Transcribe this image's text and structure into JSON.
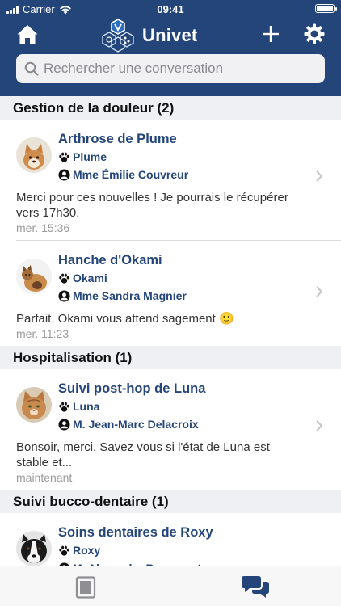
{
  "status_bar": {
    "carrier": "Carrier",
    "time": "09:41"
  },
  "header": {
    "app_name": "Univet",
    "accent_color": "#24457a",
    "icons": [
      "home-icon",
      "univet-logo",
      "plus-icon",
      "gear-icon"
    ]
  },
  "search": {
    "placeholder": "Rechercher une conversation",
    "value": ""
  },
  "sections": [
    {
      "title": "Gestion de la douleur (2)",
      "rows": [
        {
          "title": "Arthrose de Plume",
          "pet": "Plume",
          "owner": "Mme Émilie Couvreur",
          "message": "Merci pour ces nouvelles ! Je pourrais le récupérer vers 17h30.",
          "time": "mer. 15:36"
        },
        {
          "title": "Hanche d'Okami",
          "pet": "Okami",
          "owner": "Mme Sandra Magnier",
          "message": "Parfait, Okami vous attend sagement 🙂",
          "time": "mer. 11:23"
        }
      ]
    },
    {
      "title": "Hospitalisation (1)",
      "rows": [
        {
          "title": "Suivi post-hop de Luna",
          "pet": "Luna",
          "owner": "M. Jean-Marc Delacroix",
          "message": "Bonsoir, merci. Savez vous si l'état de Luna est stable et...",
          "time": "maintenant"
        }
      ]
    },
    {
      "title": "Suivi bucco-dentaire (1)",
      "rows": [
        {
          "title": "Soins dentaires de Roxy",
          "pet": "Roxy",
          "owner": "M. Alexandre Beaumont",
          "message": "",
          "time": ""
        }
      ]
    }
  ],
  "tab_bar": {
    "tabs": [
      "document-icon",
      "chat-icon"
    ],
    "active_tab": "chat-icon"
  }
}
